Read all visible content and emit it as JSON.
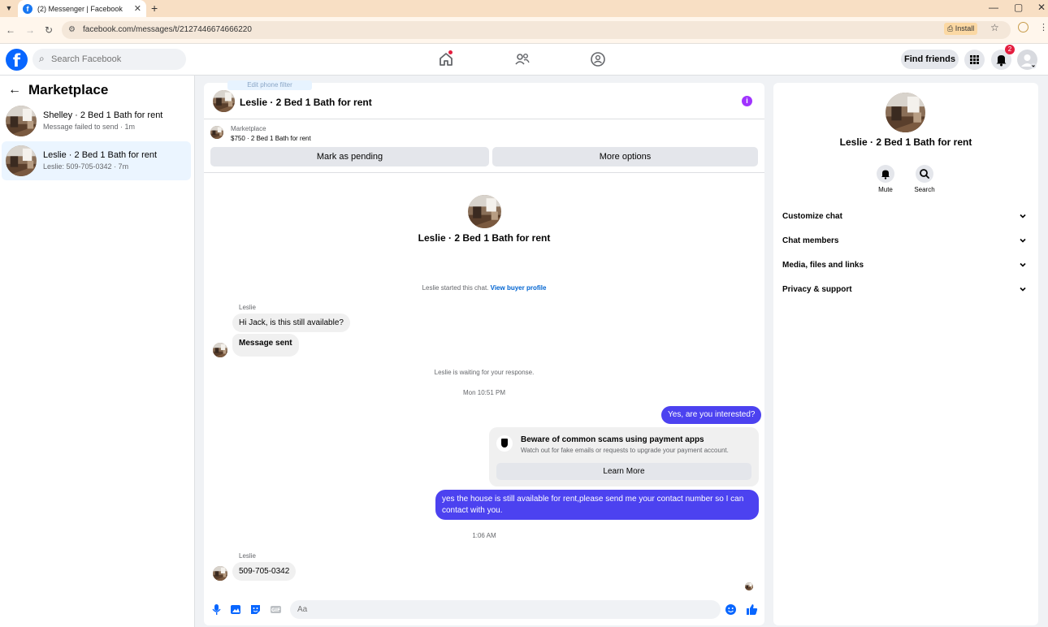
{
  "browser": {
    "tab_title": "(2) Messenger | Facebook",
    "tab_close": "✕",
    "new_tab": "+",
    "url": "facebook.com/messages/t/2127446674666220",
    "install_label": "Install",
    "window_controls": [
      "—",
      "▢",
      "✕"
    ]
  },
  "header": {
    "search_placeholder": "Search Facebook",
    "find_friends": "Find friends",
    "notification_count": "2",
    "nav_icons": [
      "home-icon",
      "friends-icon",
      "groups-icon"
    ]
  },
  "left_panel": {
    "title": "Marketplace",
    "conversations": [
      {
        "name": "Shelley · 2 Bed 1 Bath for rent",
        "preview": "Message failed to send · 1m",
        "active": false
      },
      {
        "name": "Leslie · 2 Bed 1 Bath for rent",
        "preview": "Leslie: 509-705-0342 · 7m",
        "active": true
      }
    ]
  },
  "chat": {
    "ghost_label": "Edit phone filter",
    "title": "Leslie · 2 Bed 1 Bath for rent",
    "marketplace_label": "Marketplace",
    "listing": "$750 · 2 Bed 1 Bath for rent",
    "mark_pending": "Mark as pending",
    "more_options": "More options",
    "intro_title": "Leslie · 2 Bed 1 Bath for rent",
    "started_text": "Leslie started this chat.",
    "view_profile": "View buyer profile",
    "sender_1": "Leslie",
    "msg_1": "Hi Jack, is this still available?",
    "msg_2": "Message sent",
    "waiting_text": "Leslie is waiting for your response.",
    "time_1": "Mon 10:51 PM",
    "out_1": "Yes, are you interested?",
    "scam_title": "Beware of common scams using payment apps",
    "scam_sub": "Watch out for fake emails or requests to upgrade your payment account.",
    "learn_more": "Learn More",
    "out_2": "yes the house is still available for rent,please send me your contact number so I can contact with you.",
    "time_2": "1:06 AM",
    "sender_2": "Leslie",
    "msg_3": "509-705-0342",
    "composer_placeholder": "Aa"
  },
  "right_panel": {
    "name": "Leslie · 2 Bed 1 Bath for rent",
    "mute_label": "Mute",
    "search_label": "Search",
    "rows": [
      "Customize chat",
      "Chat members",
      "Media, files and links",
      "Privacy & support"
    ]
  },
  "colors": {
    "brand_blue": "#0866ff",
    "outgoing_bubble": "#4c42f0",
    "info_purple": "#a033ff",
    "badge_red": "#e41e3f",
    "active_conv_bg": "#ebf5ff"
  }
}
